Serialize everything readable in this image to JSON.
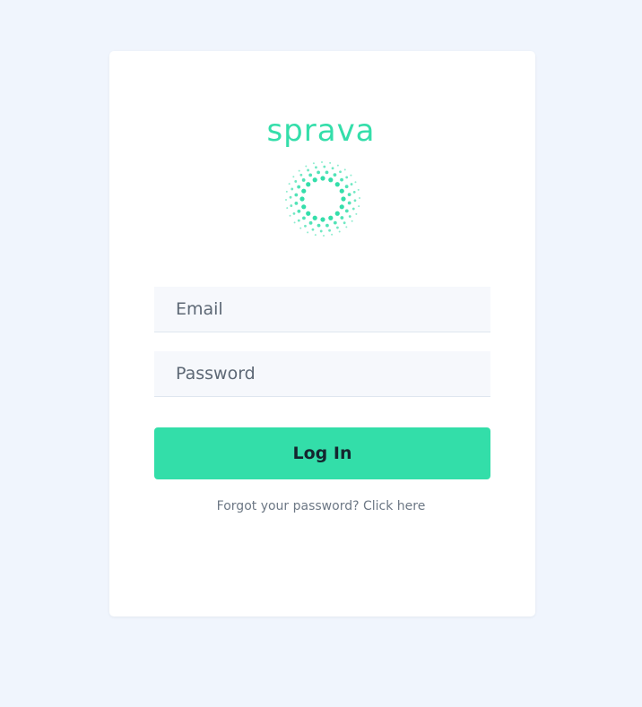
{
  "brand": {
    "wordmark": "sprava",
    "logo_icon": "dotted-circle-sunburst-icon",
    "accent_color": "#34deaa"
  },
  "login_form": {
    "email_placeholder": "Email",
    "password_placeholder": "Password",
    "submit_label": "Log In",
    "forgot_password_link": "Forgot your password? Click here",
    "button_color": "#33dea9",
    "background_color": "#f0f5fd"
  }
}
